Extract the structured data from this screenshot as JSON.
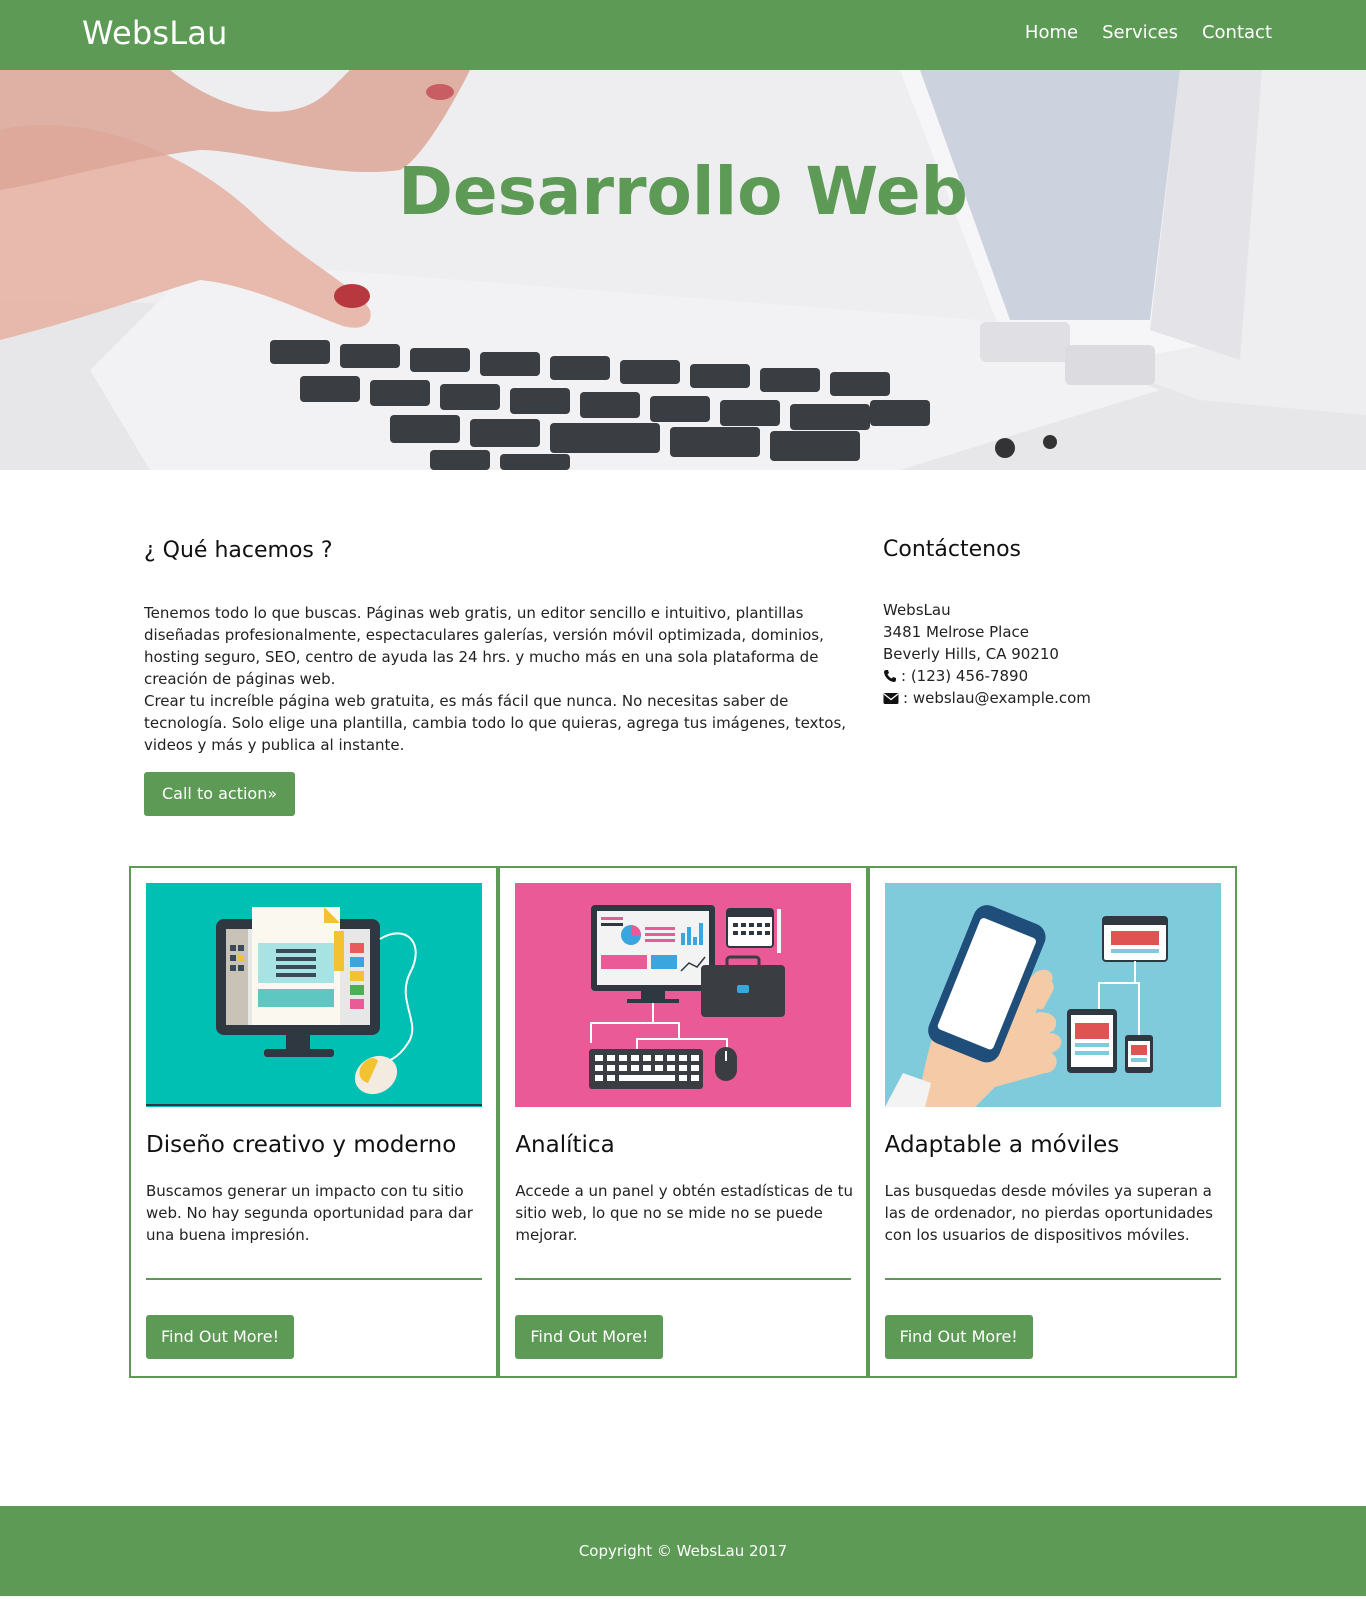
{
  "navbar": {
    "brand": "WebsLau",
    "links": [
      {
        "label": "Home"
      },
      {
        "label": "Services"
      },
      {
        "label": "Contact"
      }
    ]
  },
  "hero": {
    "title": "Desarrollo Web"
  },
  "about": {
    "heading": "¿ Qué hacemos ?",
    "paragraph1": "Tenemos todo lo que buscas. Páginas web gratis, un editor sencillo e intuitivo, plantillas diseñadas profesionalmente, espectaculares galerías, versión móvil optimizada, dominios, hosting seguro, SEO, centro de ayuda las 24 hrs. y mucho más en una sola plataforma de creación de páginas web.",
    "paragraph2": "Crear tu increíble página web gratuita, es más fácil que nunca. No necesitas saber de tecnología. Solo elige una plantilla, cambia todo lo que quieras, agrega tus imágenes, textos, videos y más y publica al instante.",
    "cta_label": "Call to action»"
  },
  "contact": {
    "heading": "Contáctenos",
    "name": "WebsLau",
    "street": "3481 Melrose Place",
    "city": "Beverly Hills, CA 90210",
    "phone": ": (123) 456-7890",
    "email": ": webslau@example.com",
    "phone_icon": "phone-icon",
    "email_icon": "envelope-icon"
  },
  "cards": [
    {
      "title": "Diseño creativo y moderno",
      "text": "Buscamos generar un impacto con tu sitio web. No hay segunda oportunidad para dar una buena impresión.",
      "button": "Find Out More!",
      "image_bg": "#00bfb3"
    },
    {
      "title": "Analítica",
      "text": "Accede a un panel y obtén estadísticas de tu sitio web, lo que no se mide no se puede mejorar.",
      "button": "Find Out More!",
      "image_bg": "#e95a97"
    },
    {
      "title": "Adaptable a móviles",
      "text": "Las busquedas desde móviles ya superan a las de ordenador, no pierdas oportunidades con los usuarios de dispositivos móviles.",
      "button": "Find Out More!",
      "image_bg": "#7fcbdc"
    }
  ],
  "footer": {
    "copyright": "Copyright © WebsLau 2017"
  },
  "colors": {
    "brand_green": "#5d9a55",
    "text": "#212529"
  }
}
